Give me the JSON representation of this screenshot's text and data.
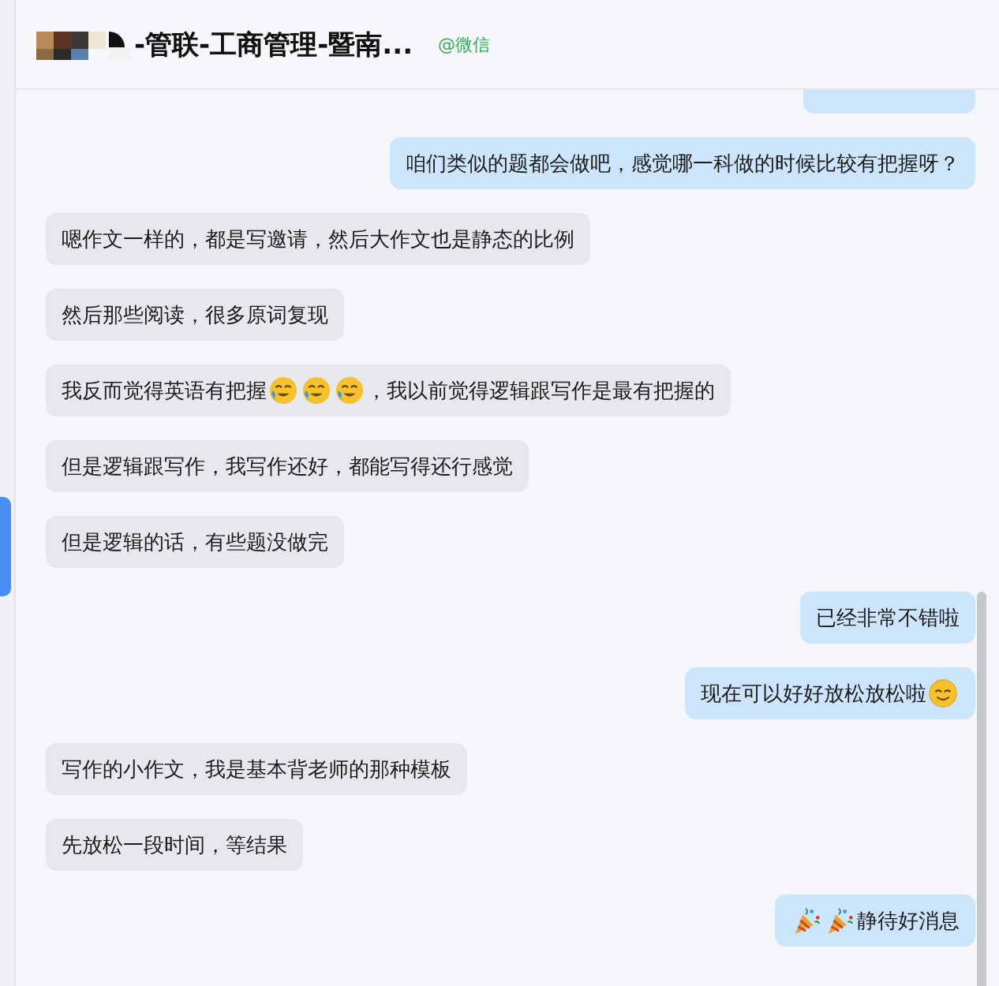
{
  "header": {
    "title": "-管联-工商管理-暨南...",
    "source": "@微信"
  },
  "messages": [
    {
      "outgoing": true,
      "segments": [
        {
          "kind": "text",
          "text": "咱们类似的题都会做吧，感觉哪一科做的时候比较有把握呀？"
        }
      ]
    },
    {
      "outgoing": false,
      "segments": [
        {
          "kind": "text",
          "text": "嗯作文一样的，都是写邀请，然后大作文也是静态的比例"
        }
      ]
    },
    {
      "outgoing": false,
      "segments": [
        {
          "kind": "text",
          "text": "然后那些阅读，很多原词复现"
        }
      ]
    },
    {
      "outgoing": false,
      "segments": [
        {
          "kind": "text",
          "text": "我反而觉得英语有把握"
        },
        {
          "kind": "laughcry"
        },
        {
          "kind": "laughcry"
        },
        {
          "kind": "laughcry"
        },
        {
          "kind": "text",
          "text": "，我以前觉得逻辑跟写作是最有把握的"
        }
      ]
    },
    {
      "outgoing": false,
      "segments": [
        {
          "kind": "text",
          "text": "但是逻辑跟写作，我写作还好，都能写得还行感觉"
        }
      ]
    },
    {
      "outgoing": false,
      "segments": [
        {
          "kind": "text",
          "text": "但是逻辑的话，有些题没做完"
        }
      ]
    },
    {
      "outgoing": true,
      "segments": [
        {
          "kind": "text",
          "text": "已经非常不错啦"
        }
      ]
    },
    {
      "outgoing": true,
      "segments": [
        {
          "kind": "text",
          "text": "现在可以好好放松放松啦"
        },
        {
          "kind": "smile"
        }
      ]
    },
    {
      "outgoing": false,
      "segments": [
        {
          "kind": "text",
          "text": "写作的小作文，我是基本背老师的那种模板"
        }
      ]
    },
    {
      "outgoing": false,
      "segments": [
        {
          "kind": "text",
          "text": "先放松一段时间，等结果"
        }
      ]
    },
    {
      "outgoing": true,
      "segments": [
        {
          "kind": "party"
        },
        {
          "kind": "party"
        },
        {
          "kind": "text",
          "text": "静待好消息"
        }
      ]
    }
  ]
}
